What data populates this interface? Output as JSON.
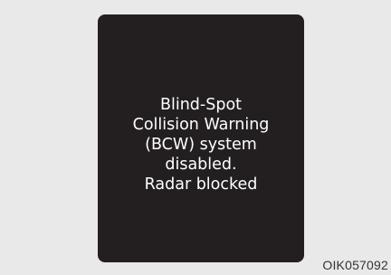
{
  "display": {
    "message_lines": [
      "Blind-Spot",
      "Collision Warning",
      "(BCW) system",
      "disabled.",
      "Radar blocked"
    ]
  },
  "figure_code": "OIK057092",
  "colors": {
    "page_background": "#e9e9ea",
    "display_background": "#231f20",
    "message_text": "#ffffff"
  }
}
